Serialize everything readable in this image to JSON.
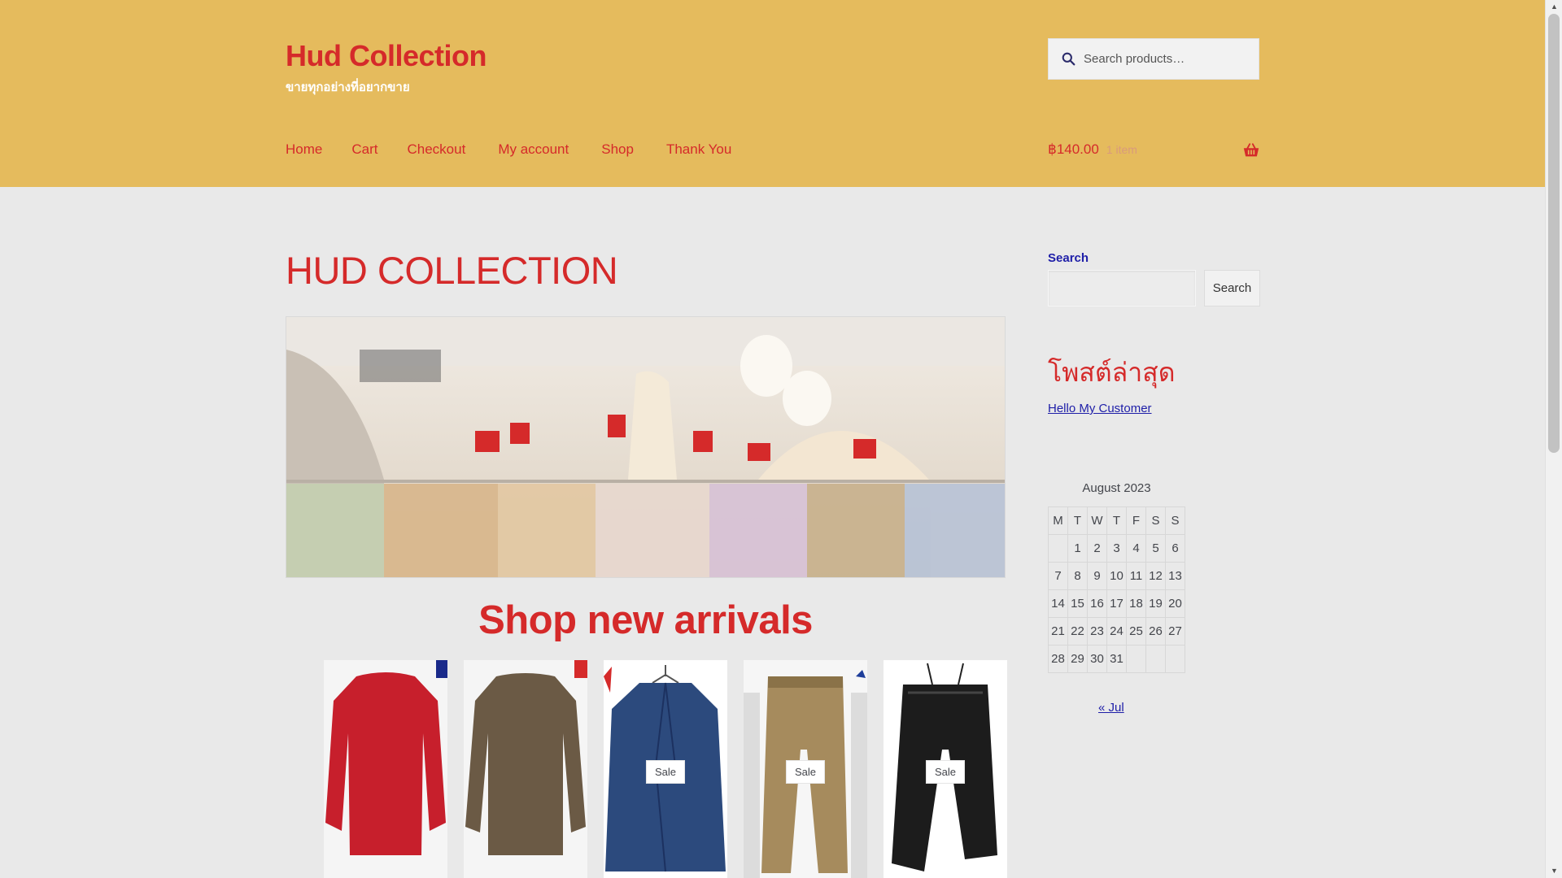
{
  "header": {
    "site_title": "Hud Collection",
    "tagline": "ขายทุกอย่างที่อยากขาย",
    "search_placeholder": "Search products…",
    "nav": [
      "Home",
      "Cart",
      "Checkout",
      "My account",
      "Shop",
      "Thank You"
    ],
    "cart_amount": "฿140.00",
    "cart_count": "1 item"
  },
  "main": {
    "page_title": "HUD COLLECTION",
    "shop_heading": "Shop new arrivals",
    "products": [
      {
        "badge": ""
      },
      {
        "badge": ""
      },
      {
        "badge": "Sale"
      },
      {
        "badge": "Sale"
      },
      {
        "badge": "Sale"
      }
    ]
  },
  "sidebar": {
    "search_label": "Search",
    "search_button": "Search",
    "recent_heading": "โพสต์ล่าสุด",
    "recent_posts": [
      "Hello My Customer"
    ],
    "calendar": {
      "caption": "August 2023",
      "weekdays": [
        "M",
        "T",
        "W",
        "T",
        "F",
        "S",
        "S"
      ],
      "weeks": [
        [
          "",
          "1",
          "2",
          "3",
          "4",
          "5",
          "6"
        ],
        [
          "7",
          "8",
          "9",
          "10",
          "11",
          "12",
          "13"
        ],
        [
          "14",
          "15",
          "16",
          "17",
          "18",
          "19",
          "20"
        ],
        [
          "21",
          "22",
          "23",
          "24",
          "25",
          "26",
          "27"
        ],
        [
          "28",
          "29",
          "30",
          "31",
          "",
          "",
          ""
        ]
      ],
      "prev_link": "« Jul"
    }
  },
  "colors": {
    "header_bg": "#e5bb5d",
    "accent_red": "#d52a2a",
    "link_blue": "#1e1ea8",
    "page_bg": "#e9e9e9"
  },
  "icons": [
    "search-icon",
    "basket-icon"
  ]
}
